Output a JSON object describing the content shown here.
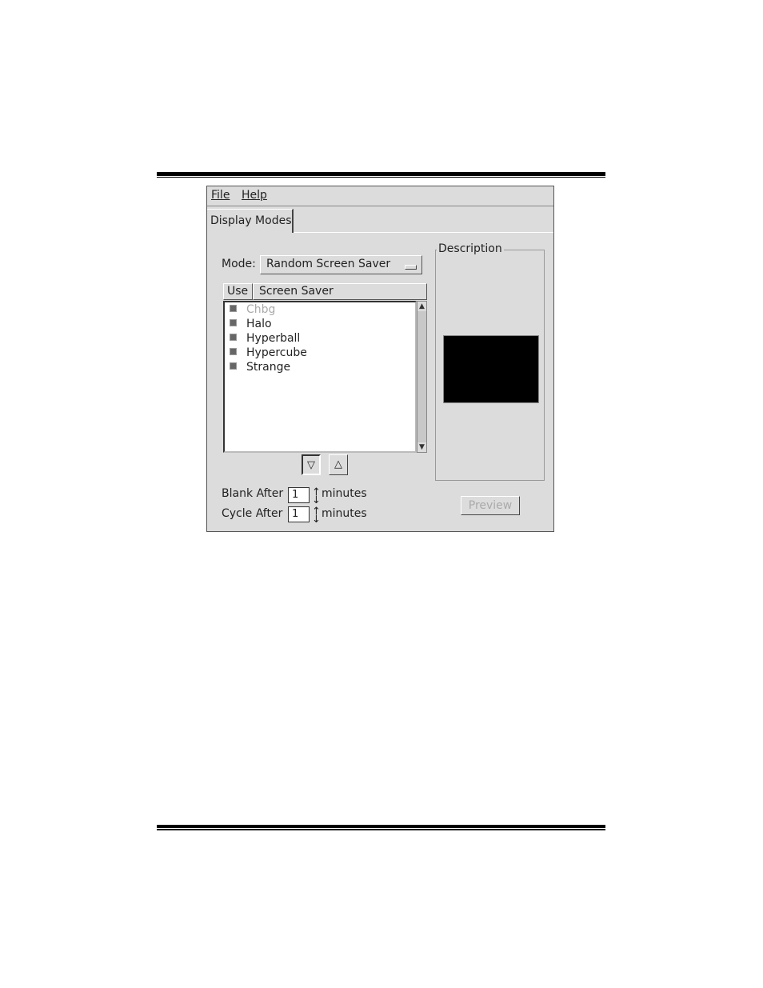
{
  "menu": {
    "file": "File",
    "help": "Help"
  },
  "tabs": [
    {
      "label": "Display Modes"
    }
  ],
  "mode": {
    "label": "Mode:",
    "value": "Random Screen Saver"
  },
  "list": {
    "headers": {
      "use": "Use",
      "screen_saver": "Screen Saver"
    },
    "items": [
      {
        "label": "Chbg",
        "enabled": false
      },
      {
        "label": "Halo",
        "enabled": true
      },
      {
        "label": "Hyperball",
        "enabled": true
      },
      {
        "label": "Hypercube",
        "enabled": true
      },
      {
        "label": "Strange",
        "enabled": true
      }
    ]
  },
  "move_buttons": {
    "down": "▽",
    "up": "△"
  },
  "blank_after": {
    "label": "Blank After",
    "value": "1",
    "unit": "minutes"
  },
  "cycle_after": {
    "label": "Cycle After",
    "value": "1",
    "unit": "minutes"
  },
  "description": {
    "title": "Description"
  },
  "preview": {
    "label": "Preview"
  }
}
